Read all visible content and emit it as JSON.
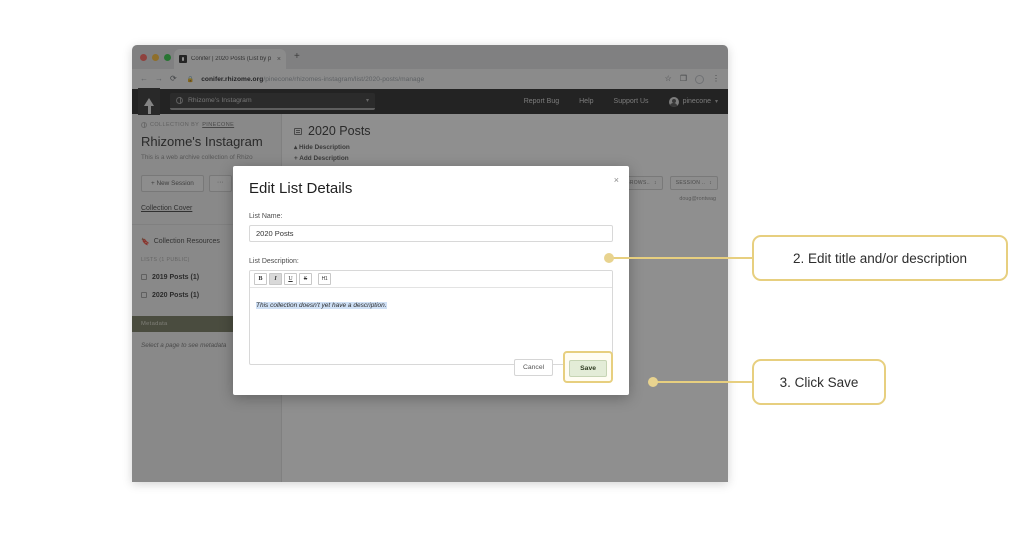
{
  "browser": {
    "tab_title": "Conifer | 2020 Posts (List by p",
    "tab_close": "×",
    "new_tab": "+",
    "back": "←",
    "forward": "→",
    "reload": "⟳",
    "lock": "🔒",
    "url_domain": "conifer.rhizome.org",
    "url_path": "/pinecone/rhizomes-instagram/list/2020-posts/manage",
    "star": "☆",
    "key": "❐",
    "menu": "⋮"
  },
  "appbar": {
    "collection_switcher": "Rhizome's Instagram",
    "caret": "▾",
    "nav": [
      "Report Bug",
      "Help",
      "Support Us"
    ],
    "user": "pinecone",
    "user_caret": "▾"
  },
  "sidebar": {
    "breadcrumb_prefix": "COLLECTION by",
    "breadcrumb_owner": "pinecone",
    "collection_title": "Rhizome's Instagram",
    "collection_desc": "This is a web archive collection of Rhizo",
    "new_session_label": "+ New Session",
    "more_label": "···",
    "collection_cover": "Collection Cover",
    "resources_icon": "🔖",
    "resources_label": "Collection Resources",
    "lists_label": "LISTS (1 Public)",
    "lists": [
      {
        "label": "2019 Posts (1)"
      },
      {
        "label": "2020 Posts (1)"
      }
    ],
    "metadata_header": "Metadata",
    "metadata_empty": "Select a page to see metadata"
  },
  "content": {
    "list_title": "2020 Posts",
    "hide_description": "▴ Hide Description",
    "add_description": "+ Add Description",
    "pill_browsers": "URE BROWS..",
    "pill_session": "SESSION ..",
    "pill_caret": "↕",
    "user_handle": "doug@rontwag"
  },
  "modal": {
    "title": "Edit List Details",
    "close": "×",
    "name_label": "List Name:",
    "name_value": "2020 Posts",
    "description_label": "List Description:",
    "toolbar": {
      "bold": "B",
      "italic": "I",
      "underline": "U",
      "strike": "S",
      "heading": "H1"
    },
    "description_text": "This collection doesn't yet have a description.",
    "cancel_label": "Cancel",
    "save_label": "Save"
  },
  "callouts": [
    {
      "text": "2. Edit title and/or description"
    },
    {
      "text": "3. Click Save"
    }
  ],
  "colors": {
    "accent": "#e7cf7f",
    "save_bg": "#e3ecd7",
    "metadata_bg": "#6f7359",
    "selection": "#cfe0f5"
  }
}
